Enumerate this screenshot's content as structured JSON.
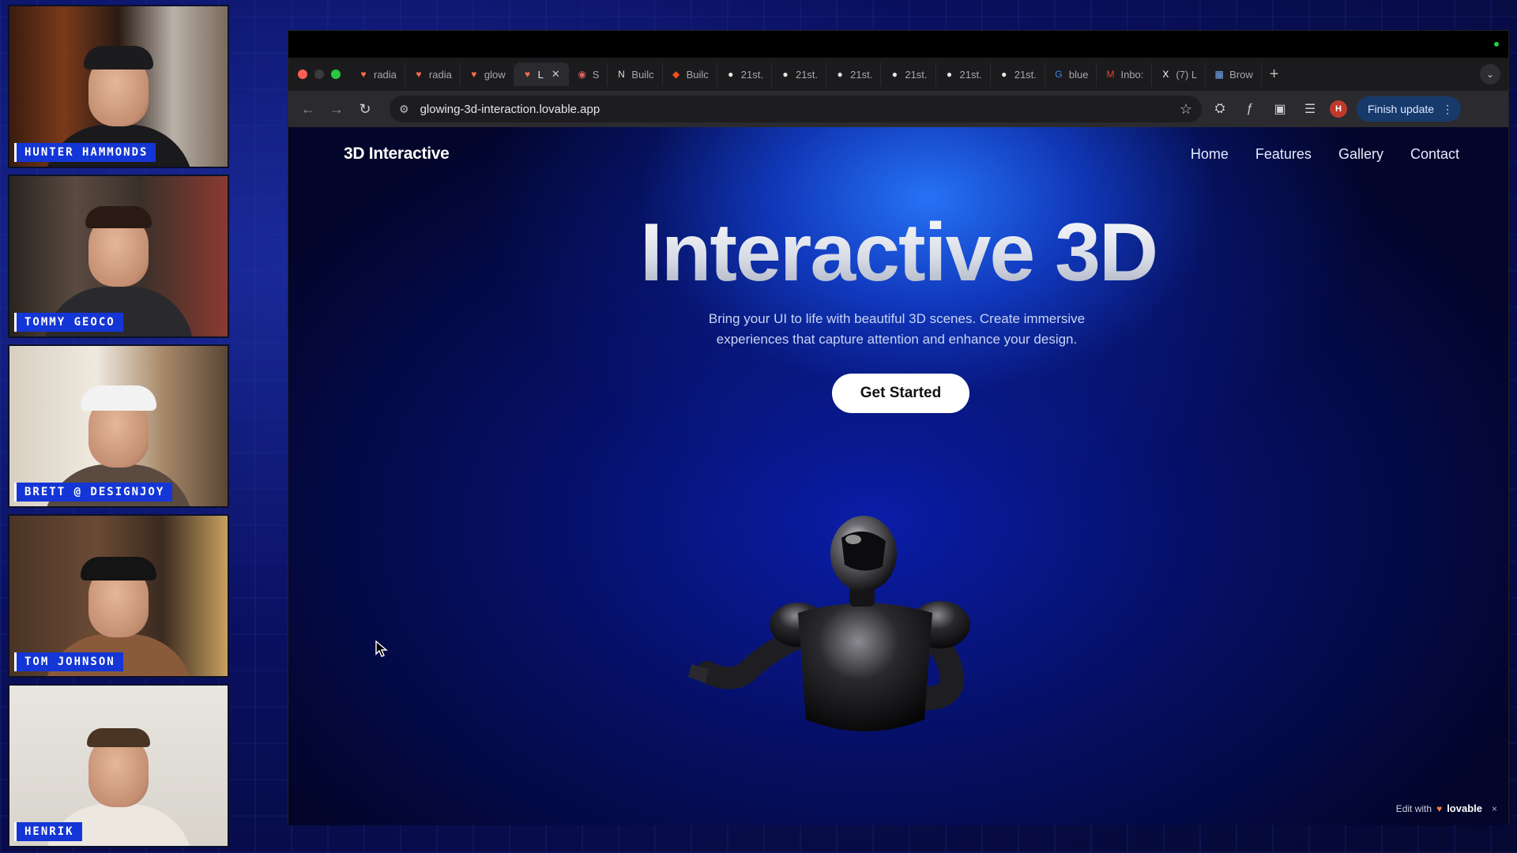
{
  "participants": [
    {
      "name": "HUNTER HAMMONDS"
    },
    {
      "name": "TOMMY GEOCO"
    },
    {
      "name": "BRETT @ DESIGNJOY"
    },
    {
      "name": "TOM JOHNSON"
    },
    {
      "name": "HENRIK"
    }
  ],
  "browser": {
    "tabs": [
      {
        "icon": "heart-icon",
        "label": "radia"
      },
      {
        "icon": "heart-icon",
        "label": "radia"
      },
      {
        "icon": "heart-icon",
        "label": "glow"
      },
      {
        "icon": "heart-icon",
        "label": "L",
        "active": true
      },
      {
        "icon": "record-icon",
        "label": "S"
      },
      {
        "icon": "notion-icon",
        "label": "Builc"
      },
      {
        "icon": "figma-icon",
        "label": "Builc"
      },
      {
        "icon": "dot-icon",
        "label": "21st."
      },
      {
        "icon": "dot-icon",
        "label": "21st."
      },
      {
        "icon": "dot-icon",
        "label": "21st."
      },
      {
        "icon": "dot-icon",
        "label": "21st."
      },
      {
        "icon": "dot-icon",
        "label": "21st."
      },
      {
        "icon": "dot-icon",
        "label": "21st."
      },
      {
        "icon": "google-icon",
        "label": "blue"
      },
      {
        "icon": "gmail-icon",
        "label": "Inbo:"
      },
      {
        "icon": "x-icon",
        "label": "(7) L"
      },
      {
        "icon": "grid-icon",
        "label": "Brow"
      }
    ],
    "url": "glowing-3d-interaction.lovable.app",
    "profile_initial": "H",
    "finish_update_label": "Finish update"
  },
  "site": {
    "logo": "3D Interactive",
    "nav": [
      "Home",
      "Features",
      "Gallery",
      "Contact"
    ],
    "hero_title": "Interactive 3D",
    "hero_subtitle": "Bring your UI to life with beautiful 3D scenes. Create immersive experiences that capture attention and enhance your design.",
    "cta_label": "Get Started",
    "badge_prefix": "Edit with",
    "badge_brand": "lovable",
    "badge_close": "×"
  },
  "colors": {
    "nameplate": "#1436d6",
    "hero_glow": "#2878ff",
    "cta_bg": "#ffffff",
    "finish_update_bg": "#173a6b"
  }
}
